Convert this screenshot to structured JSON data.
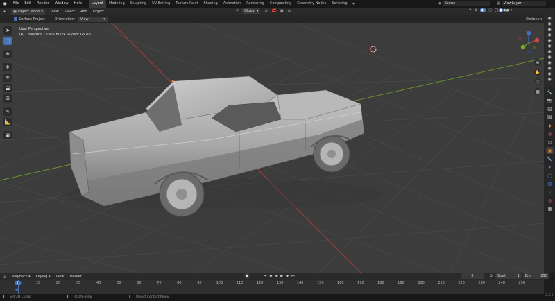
{
  "topbar": {
    "menus": [
      "File",
      "Edit",
      "Render",
      "Window",
      "Help"
    ],
    "tabs": [
      "Layout",
      "Modeling",
      "Sculpting",
      "UV Editing",
      "Texture Paint",
      "Shading",
      "Animation",
      "Rendering",
      "Compositing",
      "Geometry Nodes",
      "Scripting"
    ],
    "active_tab": "Layout",
    "scene": "Scene",
    "view_layer": "ViewLayer"
  },
  "header": {
    "mode": "Object Mode",
    "menus": [
      "View",
      "Select",
      "Add",
      "Object"
    ],
    "transform_orientation": "Global"
  },
  "tool_options": {
    "surface_project": "Surface Project",
    "orientation_label": "Orientation:",
    "orientation_value": "View",
    "options": "Options"
  },
  "viewport": {
    "view_name": "User Perspective",
    "collection_line": "(0) Collection | 1965 Buick Skylark GS.007"
  },
  "timeline": {
    "menus": [
      "Playback",
      "Keying",
      "View",
      "Marker"
    ],
    "current_frame": "0",
    "start_label": "Start",
    "start_value": "1",
    "end_label": "End",
    "end_value": "250",
    "ruler_labels": [
      "0",
      "10",
      "20",
      "30",
      "40",
      "50",
      "60",
      "70",
      "80",
      "90",
      "100",
      "110",
      "120",
      "130",
      "140",
      "150",
      "160",
      "170",
      "180",
      "190",
      "200",
      "210",
      "220",
      "230",
      "240",
      "250"
    ]
  },
  "statusbar": {
    "left": "Set 3D Cursor",
    "middle": "Rotate View",
    "right": "Object Context Menu",
    "version": "3.4.0"
  },
  "colors": {
    "accent": "#4772b3",
    "viewport_bg": "#3c3c3c",
    "x_axis": "#b53c3c",
    "y_axis": "#6f9b2a"
  }
}
